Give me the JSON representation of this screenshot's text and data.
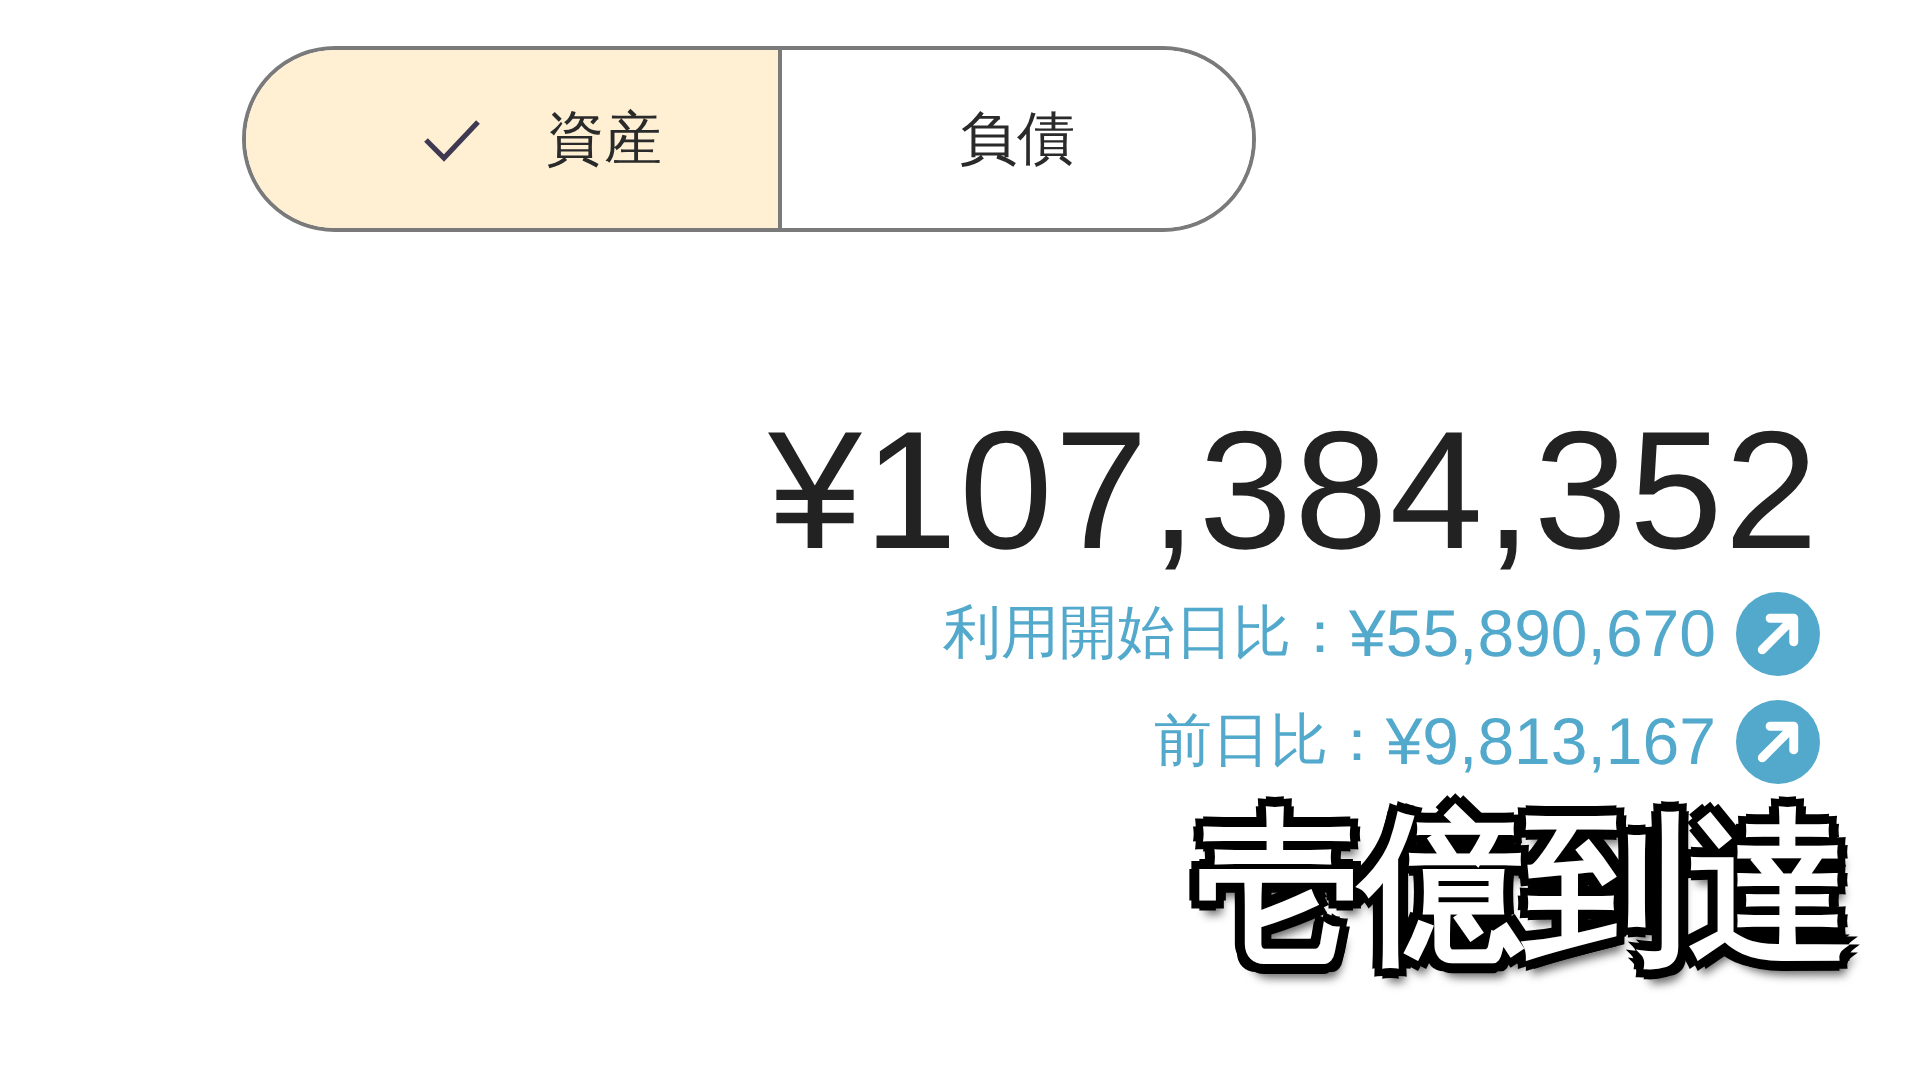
{
  "segments": [
    {
      "label": "資産",
      "selected": true
    },
    {
      "label": "負債",
      "selected": false
    }
  ],
  "total": "¥107,384,352",
  "comparisons": [
    {
      "label": "利用開始日比：",
      "value": "¥55,890,670"
    },
    {
      "label": "前日比：",
      "value": "¥9,813,167"
    }
  ],
  "caption": "壱億到達"
}
